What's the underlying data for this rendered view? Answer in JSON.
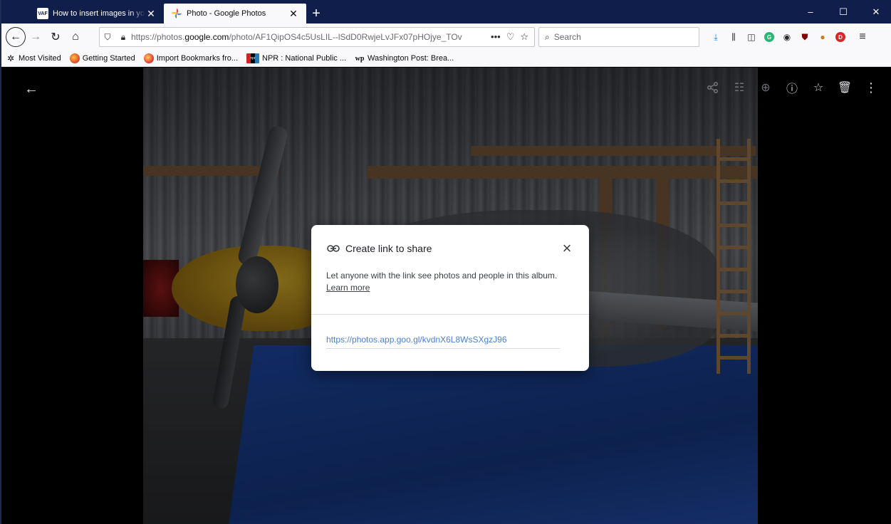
{
  "browser": {
    "tabs": [
      {
        "title": "How to insert images in your p",
        "favicon": "VAF",
        "active": false
      },
      {
        "title": "Photo - Google Photos",
        "active": true
      }
    ],
    "new_tab": "+",
    "window_controls": {
      "minimize": "–",
      "maximize": "☐",
      "close": "✕"
    },
    "url_prefix": "https://photos.",
    "url_domain": "google.com",
    "url_path": "/photo/AF1QipOS4c5UsLIL--lSdD0RwjeLvJFx07pHOjye_TOv",
    "url_more": "•••",
    "search_placeholder": "Search",
    "bookmarks": [
      {
        "label": "Most Visited"
      },
      {
        "label": "Getting Started"
      },
      {
        "label": "Import Bookmarks fro..."
      },
      {
        "label": "NPR : National Public ...",
        "badge": "npr"
      },
      {
        "label": "Washington Post: Brea...",
        "badge": "wp"
      }
    ],
    "extensions": [
      {
        "letter": "G",
        "color": "#2bb673"
      },
      {
        "letter": "D",
        "color": "#d8262a"
      }
    ]
  },
  "dialog": {
    "title": "Create link to share",
    "description": "Let anyone with the link see photos and people in this album.",
    "learn_more": "Learn more",
    "share_url": "https://photos.app.goo.gl/kvdnX6L8WsSXgzJ96"
  }
}
